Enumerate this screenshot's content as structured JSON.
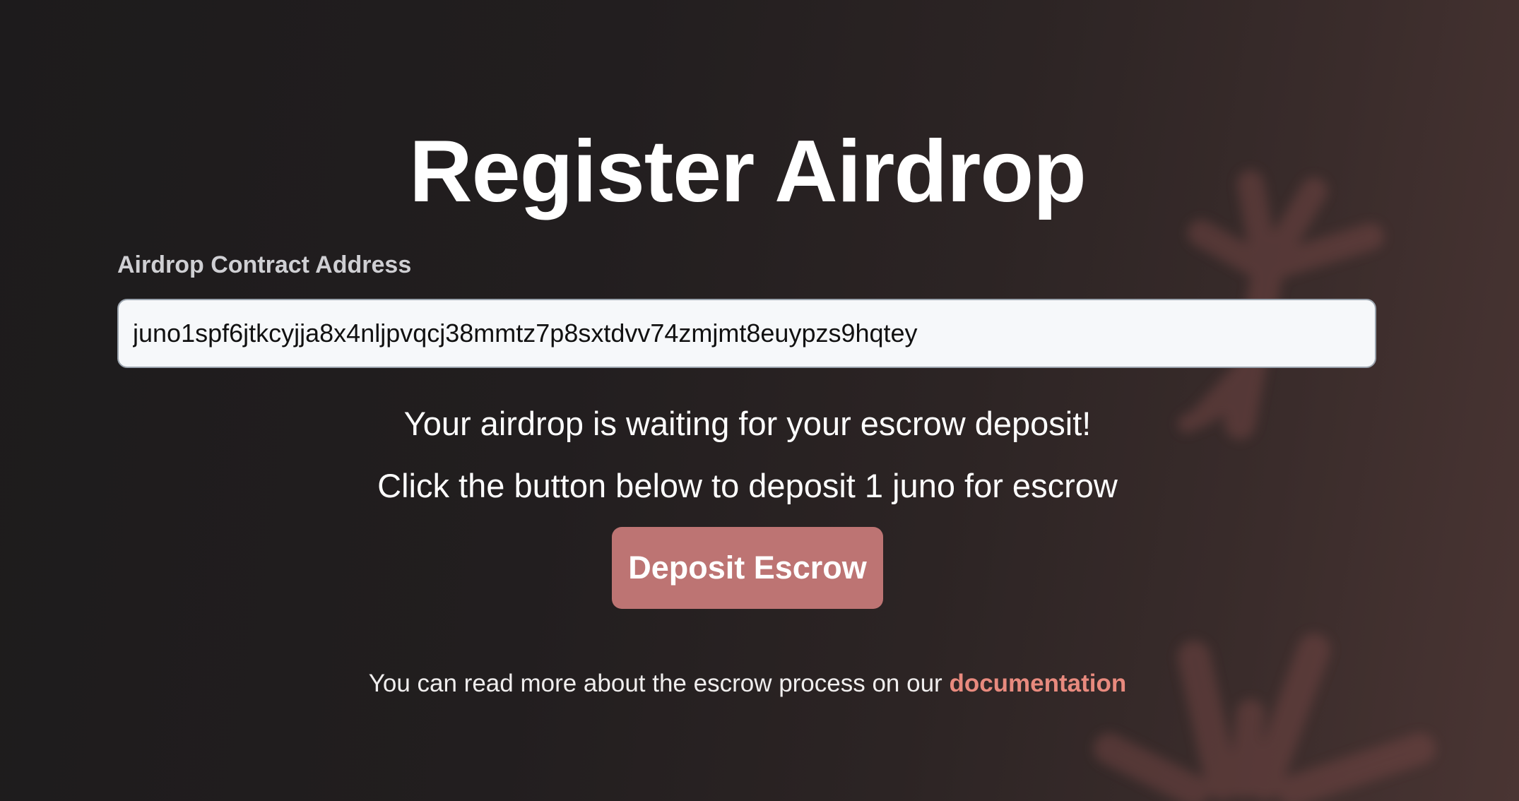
{
  "page": {
    "title": "Register Airdrop"
  },
  "form": {
    "address_label": "Airdrop Contract Address",
    "address_value": "juno1spf6jtkcyjja8x4nljpvqcj38mmtz7p8sxtdvv74zmjmt8euypzs9hqtey"
  },
  "status": {
    "line1": "Your airdrop is waiting for your escrow deposit!",
    "line2": "Click the button below to deposit 1 juno for escrow"
  },
  "actions": {
    "deposit_label": "Deposit Escrow"
  },
  "footer": {
    "text": "You can read more about the escrow process on our ",
    "link_label": "documentation"
  },
  "colors": {
    "button": "#bd7473",
    "link": "#e88a7e",
    "decoration": "#7a4a46"
  }
}
